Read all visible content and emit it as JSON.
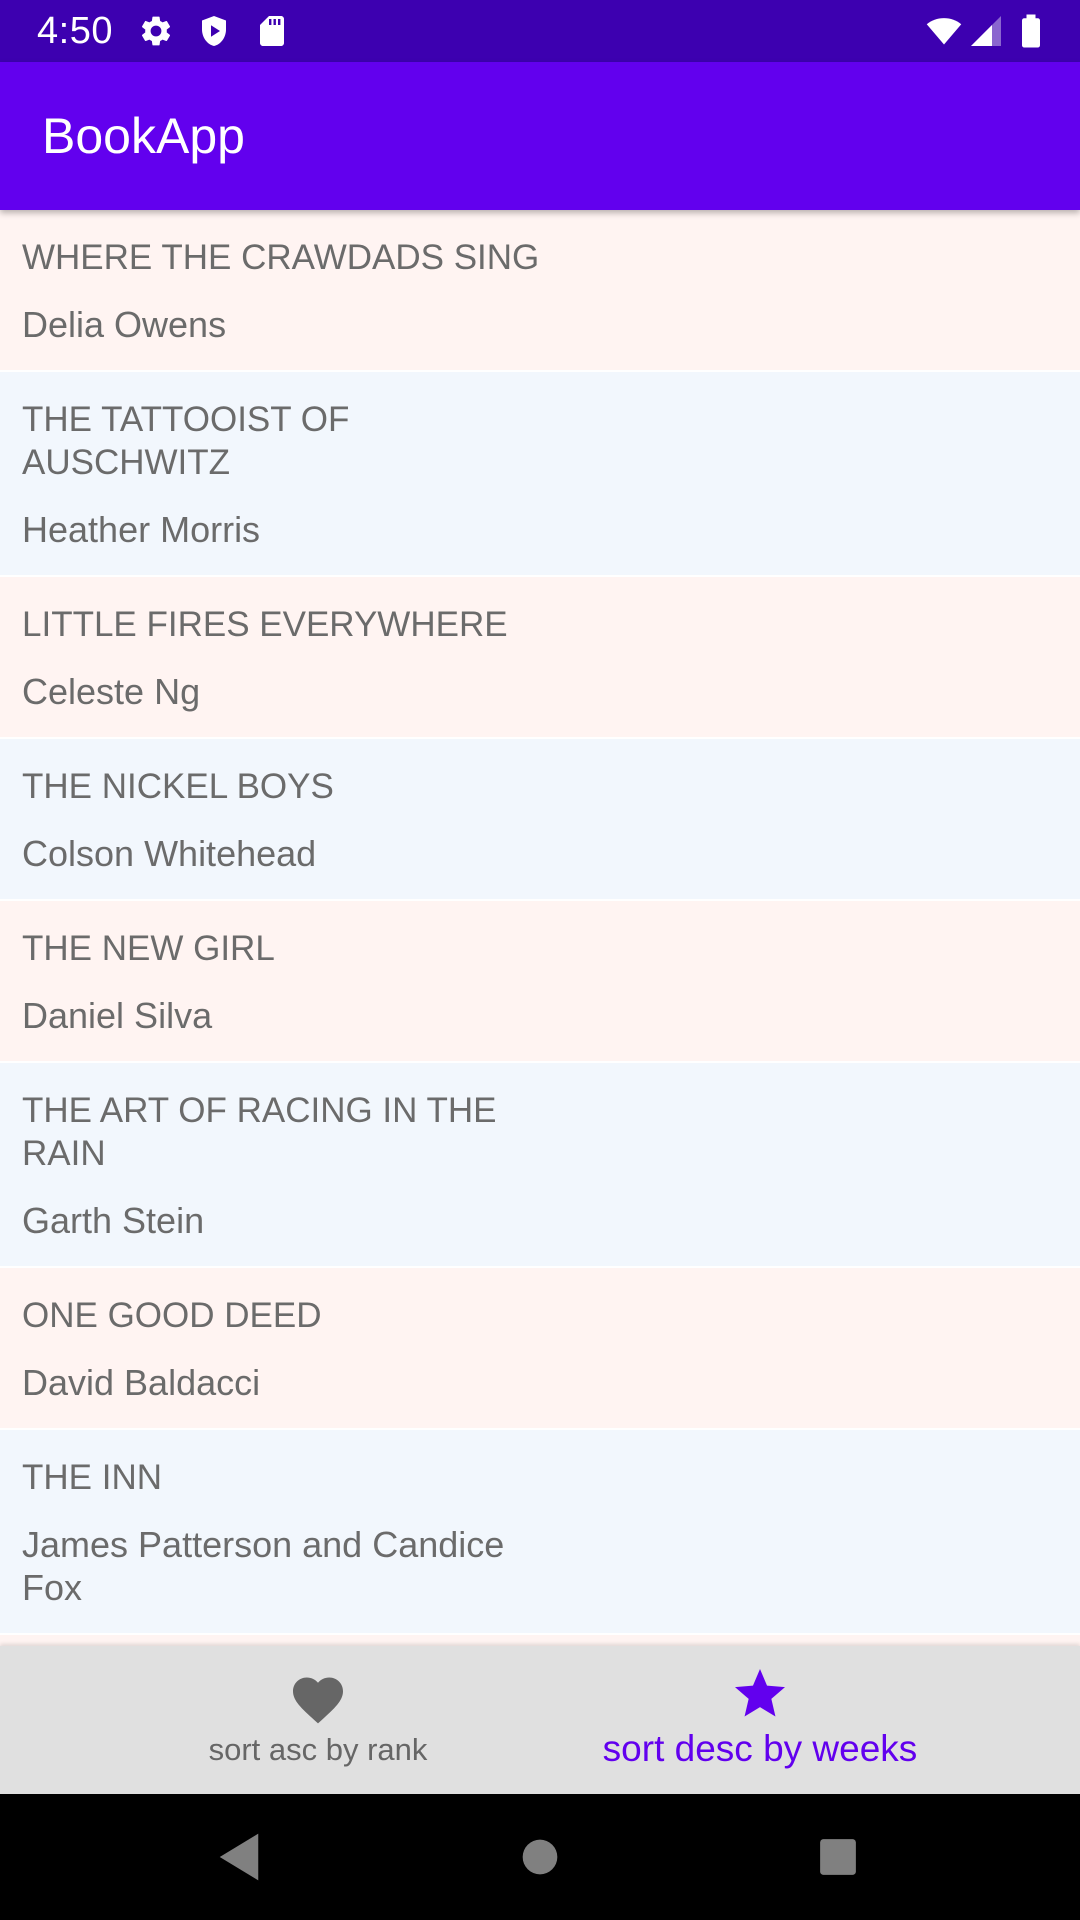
{
  "status_bar": {
    "time": "4:50",
    "icons": [
      "gear-icon",
      "shield-icon",
      "sd-card-icon",
      "wifi-icon",
      "cellular-signal-icon",
      "battery-icon"
    ]
  },
  "app_bar": {
    "title": "BookApp"
  },
  "colors": {
    "status_bar": "#3d00b0",
    "app_bar": "#6200ee",
    "row_pink": "#fff4f2",
    "row_blue": "#f2f7fd",
    "text_gray": "#6b6b6b",
    "accent": "#6200ee",
    "nav_background": "#e0e0e0",
    "nav_inactive": "#666666"
  },
  "books": [
    {
      "title": "WHERE THE CRAWDADS SING",
      "author": "Delia Owens"
    },
    {
      "title": "THE TATTOOIST OF AUSCHWITZ",
      "author": "Heather Morris"
    },
    {
      "title": "LITTLE FIRES EVERYWHERE",
      "author": "Celeste Ng"
    },
    {
      "title": "THE NICKEL BOYS",
      "author": "Colson Whitehead"
    },
    {
      "title": "THE NEW GIRL",
      "author": "Daniel Silva"
    },
    {
      "title": "THE ART OF RACING IN THE RAIN",
      "author": "Garth Stein"
    },
    {
      "title": "ONE GOOD DEED",
      "author": "David Baldacci"
    },
    {
      "title": "THE INN",
      "author": "James Patterson and Candice Fox"
    }
  ],
  "bottom_nav": {
    "items": [
      {
        "label": "sort asc by rank",
        "icon": "heart-icon",
        "selected": false
      },
      {
        "label": "sort desc by weeks",
        "icon": "star-icon",
        "selected": true
      }
    ]
  },
  "system_nav": {
    "buttons": [
      "back-icon",
      "home-icon",
      "recents-icon"
    ]
  }
}
